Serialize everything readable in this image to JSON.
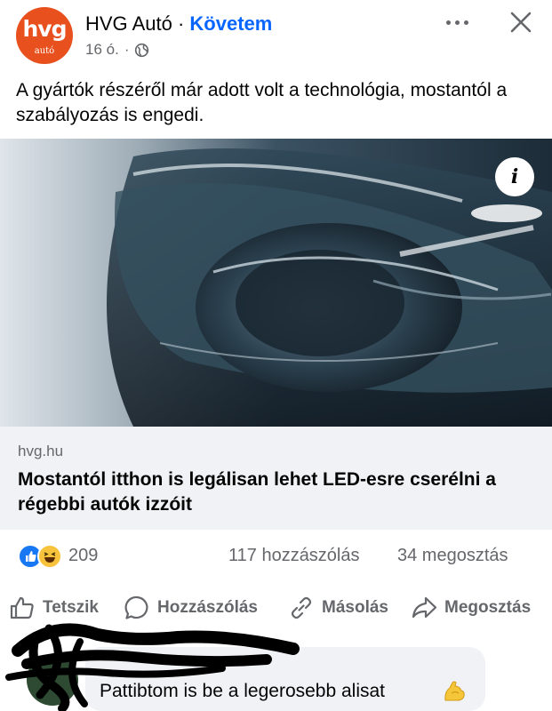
{
  "header": {
    "avatar_logo_main": "hvg",
    "avatar_logo_sub": "autó",
    "page_name": "HVG Autó",
    "separator": " · ",
    "follow_label": "Követem",
    "time": "16 ó.",
    "meta_separator": "·",
    "privacy_icon": "globe-icon",
    "more_icon": "more-icon",
    "close_icon": "close-icon"
  },
  "post": {
    "text": "A gyártók részéről már adott volt a technológia, mostantól a szabályozás is engedi."
  },
  "media": {
    "image": "car-headlight-photo",
    "info_label": "i"
  },
  "link": {
    "domain": "hvg.hu",
    "title": "Mostantól itthon is legálisan lehet LED-esre cserélni a régebbi autók izzóit"
  },
  "stats": {
    "reactions": [
      "like",
      "haha"
    ],
    "reaction_count": "209",
    "comments": "117 hozzászólás",
    "shares": "34 megosztás"
  },
  "actions": [
    {
      "label": "Tetszik",
      "icon": "thumbs-up-icon"
    },
    {
      "label": "Hozzászólás",
      "icon": "comment-icon"
    },
    {
      "label": "Másolás",
      "icon": "link-icon"
    },
    {
      "label": "Megosztás",
      "icon": "share-icon"
    }
  ],
  "comment": {
    "text": "Pattibtom is be a legerosebb alisat",
    "emoji": "flexed-biceps-icon"
  },
  "colors": {
    "accent": "#0866ff",
    "brand": "#e8501e",
    "secondary_text": "#65676b",
    "card_bg": "#f0f2f5"
  }
}
